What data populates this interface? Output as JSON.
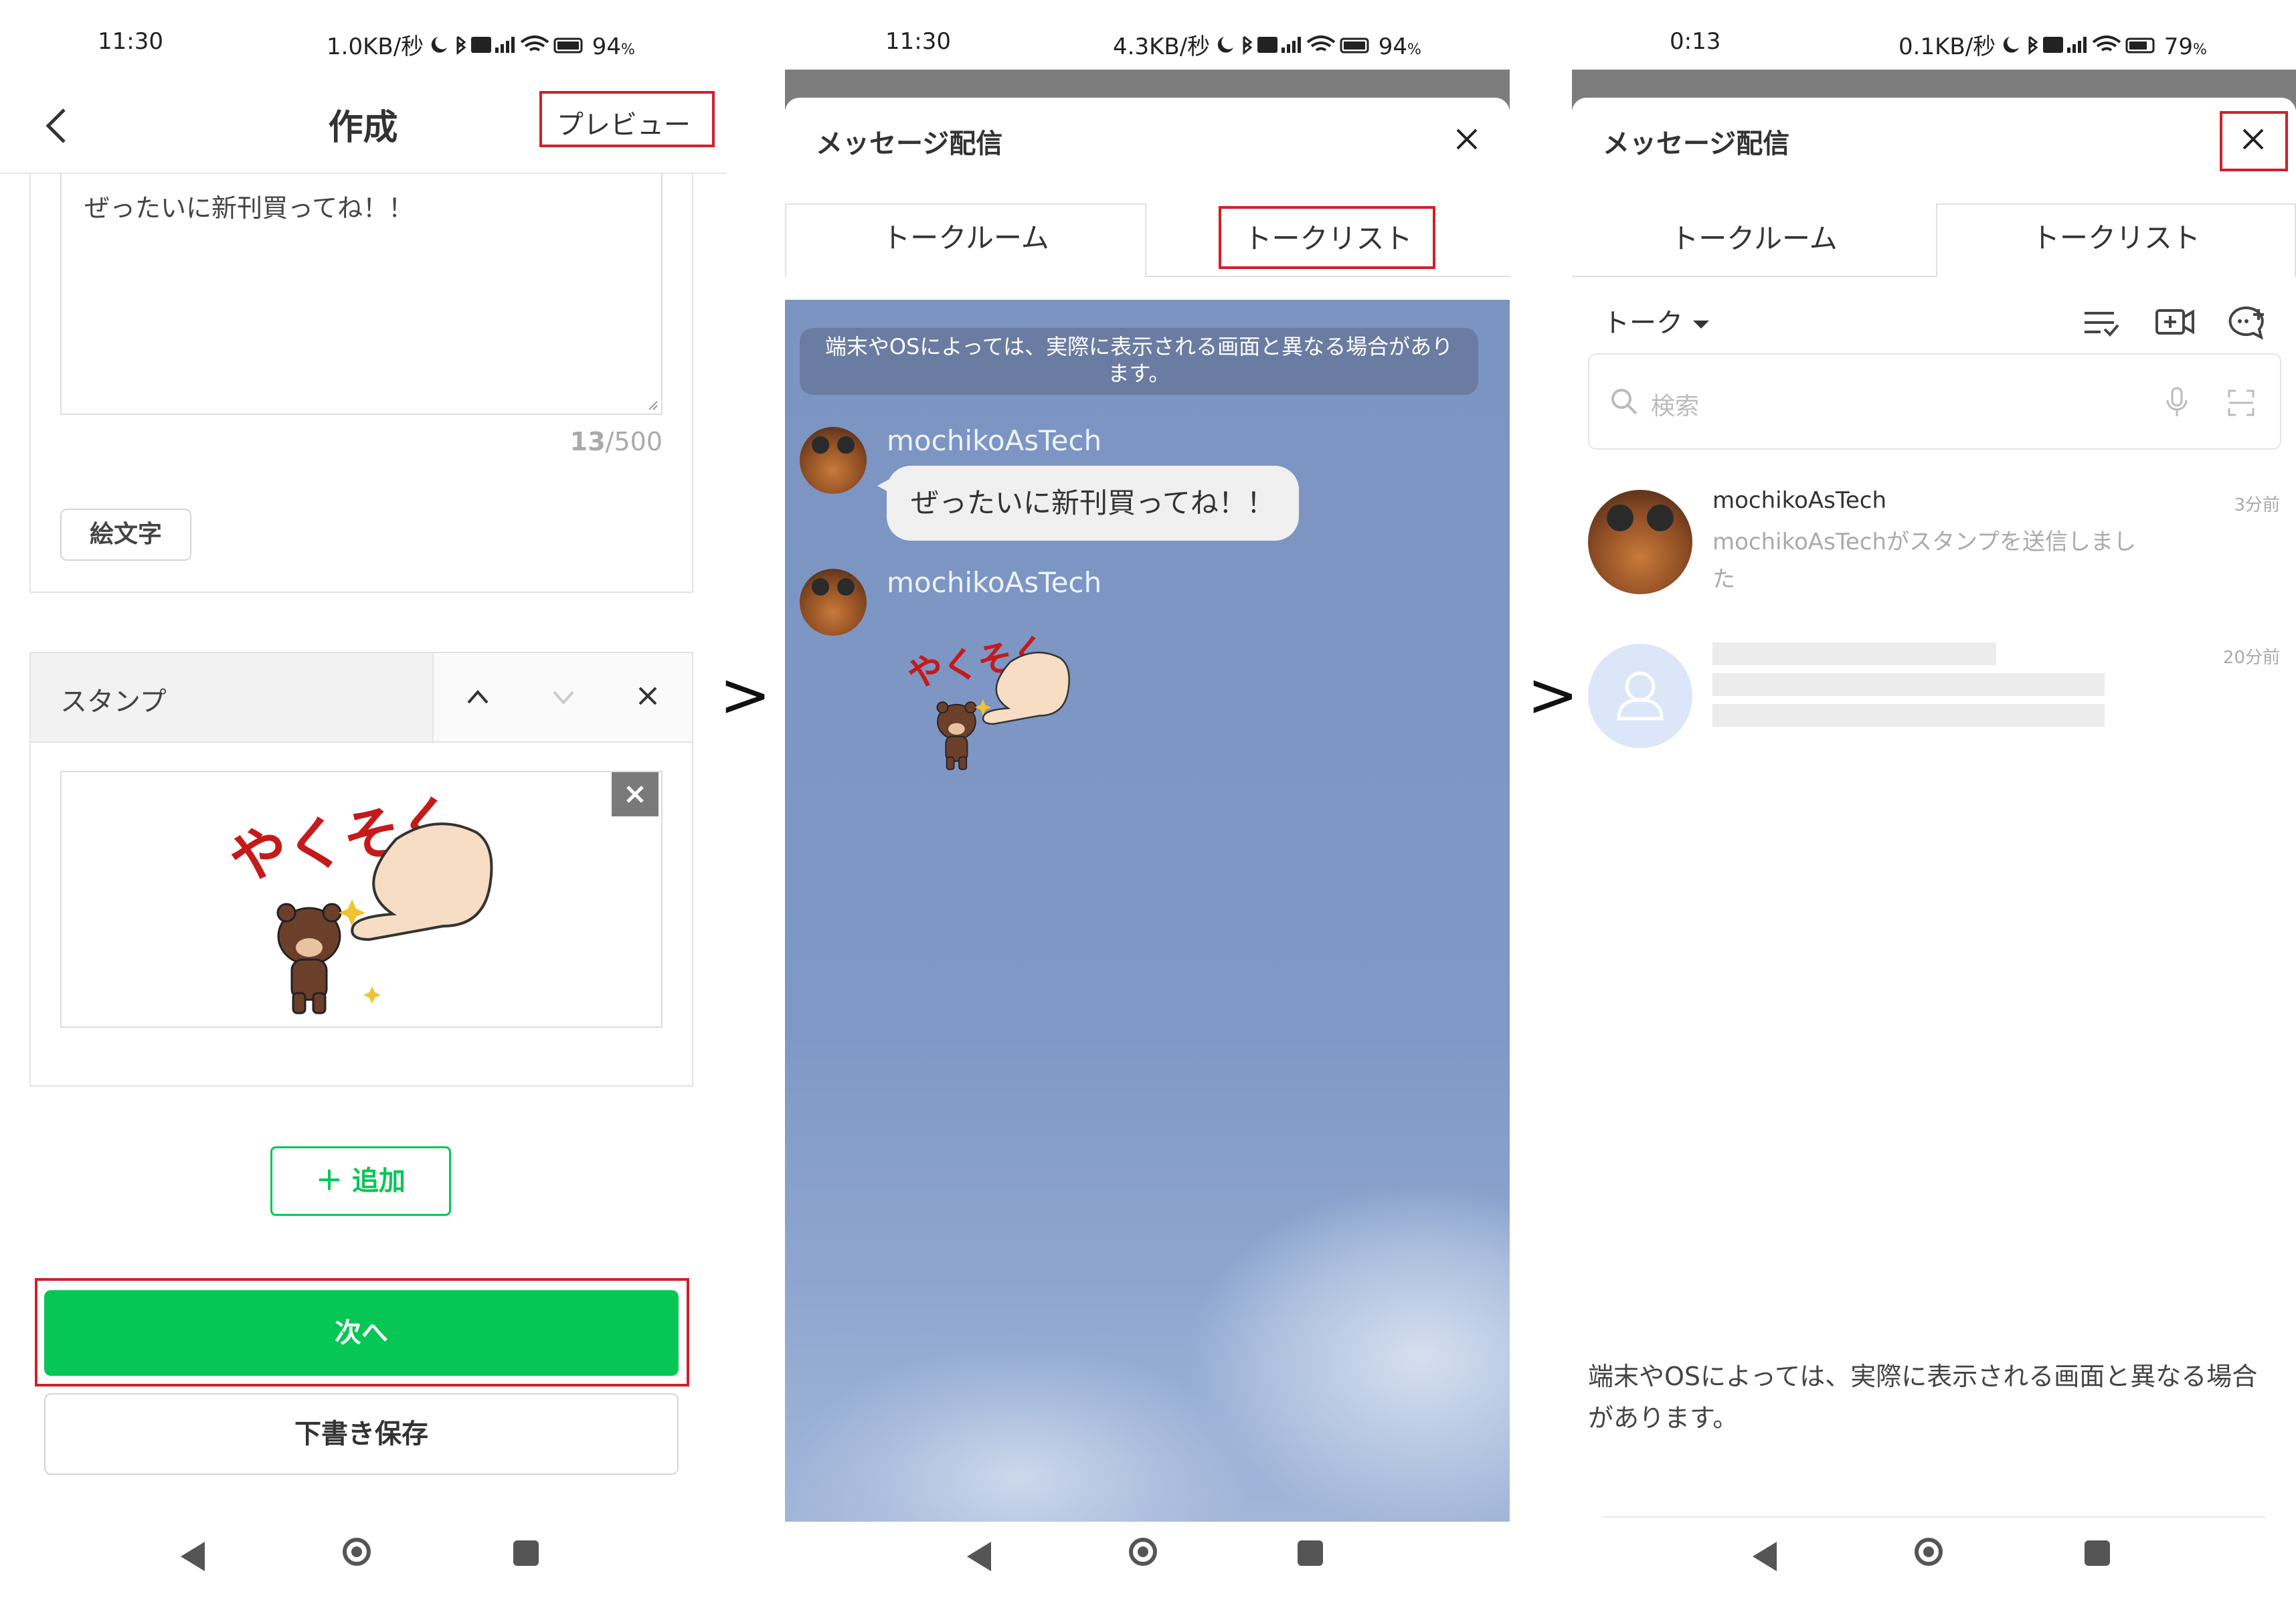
{
  "panel1": {
    "status": {
      "time": "11:30",
      "speed": "1.0KB/秒",
      "battery": "94"
    },
    "header": {
      "title": "作成",
      "preview_label": "プレビュー"
    },
    "message_text": "ぜったいに新刊買ってね！！",
    "counter": {
      "current": "13",
      "max": "/500"
    },
    "emoji_button": "絵文字",
    "stamp_section": {
      "title": "スタンプ"
    },
    "sticker_text": "やくそく",
    "add_button": "＋ 追加",
    "next_button": "次へ",
    "draft_button": "下書き保存"
  },
  "separator": ">",
  "panel2": {
    "status": {
      "time": "11:30",
      "speed": "4.3KB/秒",
      "battery": "94"
    },
    "modal_title": "メッセージ配信",
    "tabs": [
      "トークルーム",
      "トークリスト"
    ],
    "notice": "端末やOSによっては、実際に表示される画面と異なる場合があります。",
    "messages": [
      {
        "sender": "mochikoAsTech",
        "text": "ぜったいに新刊買ってね！！"
      },
      {
        "sender": "mochikoAsTech",
        "text": ""
      }
    ],
    "sticker_text": "やくそく"
  },
  "panel3": {
    "status": {
      "time": "0:13",
      "speed": "0.1KB/秒",
      "battery": "79"
    },
    "modal_title": "メッセージ配信",
    "tabs": [
      "トークルーム",
      "トークリスト"
    ],
    "list_header": "トーク",
    "search_placeholder": "検索",
    "chats": [
      {
        "name": "mochikoAsTech",
        "preview": "mochikoAsTechがスタンプを送信しました",
        "time": "3分前"
      },
      {
        "name": "",
        "preview": "",
        "time": "20分前"
      }
    ],
    "notice": "端末やOSによっては、実際に表示される画面と異なる場合があります。"
  },
  "colors": {
    "line_green": "#06c755",
    "highlight_red": "#d0202a",
    "chat_bg": "#7f97c3"
  }
}
